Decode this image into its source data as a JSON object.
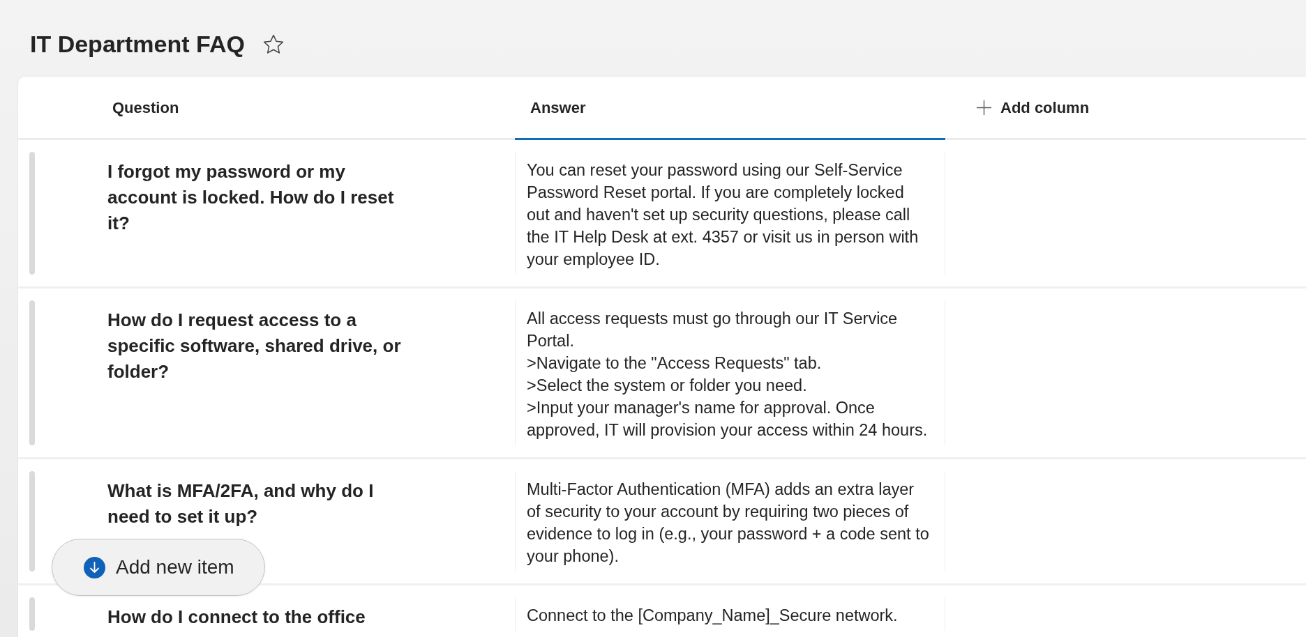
{
  "page": {
    "title": "IT Department FAQ",
    "favorite": false
  },
  "columns": [
    {
      "label": "Question",
      "selected": false
    },
    {
      "label": "Answer",
      "selected": true
    }
  ],
  "add_column": {
    "label": "Add column"
  },
  "rows": [
    {
      "question": "I forgot my password or my account is locked. How do I reset it?",
      "answer": "You can reset your password using our Self-Service Password Reset portal. If you are completely locked out and haven't set up security questions, please call the IT Help Desk at ext. 4357 or visit us in person with your employee ID."
    },
    {
      "question": "How do I request access to a specific software, shared drive, or folder?",
      "answer": "All access requests must go through our IT Service Portal.\n>Navigate to the \"Access Requests\" tab.\n>Select the system or folder you need.\n>Input your manager's name for approval. Once approved, IT will provision your access within 24 hours."
    },
    {
      "question": "What is MFA/2FA, and why do I need to set it up?",
      "answer": "Multi-Factor Authentication (MFA) adds an extra layer of security to your account by requiring two pieces of evidence to log in (e.g., your password + a code sent to your phone)."
    },
    {
      "question": "How do I connect to the office",
      "answer": "Connect to the [Company_Name]_Secure network."
    }
  ],
  "add_item_button": {
    "label": "Add new item"
  }
}
